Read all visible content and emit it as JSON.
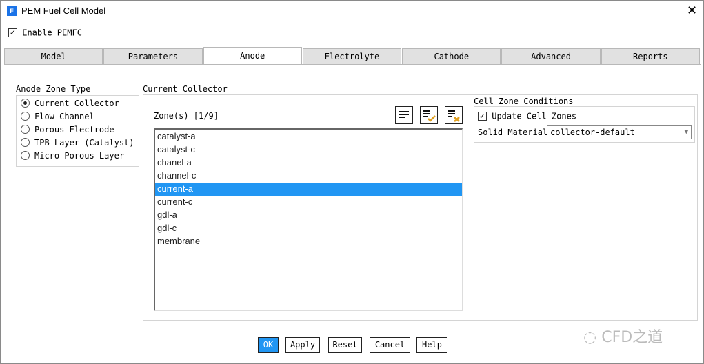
{
  "window": {
    "title": "PEM Fuel Cell Model",
    "icon_letter": "F",
    "close": "✕"
  },
  "enable_pemfc": {
    "label": "Enable PEMFC",
    "checked": true
  },
  "tabs": [
    {
      "label": "Model"
    },
    {
      "label": "Parameters"
    },
    {
      "label": "Anode",
      "active": true
    },
    {
      "label": "Electrolyte"
    },
    {
      "label": "Cathode"
    },
    {
      "label": "Advanced"
    },
    {
      "label": "Reports"
    }
  ],
  "zone_type": {
    "title": "Anode Zone Type",
    "options": [
      {
        "label": "Current Collector",
        "selected": true
      },
      {
        "label": "Flow Channel"
      },
      {
        "label": "Porous Electrode"
      },
      {
        "label": "TPB Layer (Catalyst)"
      },
      {
        "label": "Micro Porous Layer"
      }
    ]
  },
  "collector": {
    "title": "Current Collector",
    "zones_label": "Zone(s) [1/9]",
    "zones": [
      "catalyst-a",
      "catalyst-c",
      "chanel-a",
      "channel-c",
      "current-a",
      "current-c",
      "gdl-a",
      "gdl-c",
      "membrane"
    ],
    "selected_index": 4
  },
  "cell_zone": {
    "title": "Cell Zone Conditions",
    "update_label": "Update Cell Zones",
    "update_checked": true,
    "material_label": "Solid Material",
    "material_value": "collector-default"
  },
  "buttons": {
    "ok": "OK",
    "apply": "Apply",
    "reset": "Reset",
    "cancel": "Cancel",
    "help": "Help"
  },
  "watermark": "CFD之道",
  "colors": {
    "accent": "#2196f3",
    "check_orange": "#e0a020"
  }
}
